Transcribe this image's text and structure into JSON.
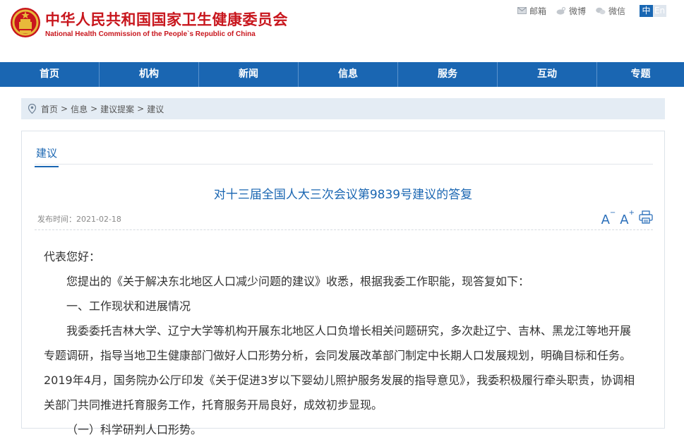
{
  "header": {
    "title": "中华人民共和国国家卫生健康委员会",
    "subtitle": "National Health Commission of the People`s Republic of China"
  },
  "toplinks": {
    "mail": "邮箱",
    "weibo": "微博",
    "wechat": "微信",
    "lang_zh": "中",
    "lang_en": "En"
  },
  "nav": {
    "items": [
      "首页",
      "机构",
      "新闻",
      "信息",
      "服务",
      "互动",
      "专题"
    ]
  },
  "breadcrumb": {
    "items": [
      "首页",
      "信息",
      "建议提案",
      "建议"
    ],
    "separator": ">"
  },
  "section": {
    "tab": "建议"
  },
  "article": {
    "title": "对十三届全国人大三次会议第9839号建议的答复",
    "date_label": "发布时间：",
    "date": "2021-02-18",
    "font_increase": "A",
    "font_decrease": "A",
    "paragraphs": [
      "代表您好：",
      "您提出的《关于解决东北地区人口减少问题的建议》收悉，根据我委工作职能，现答复如下：",
      "一、工作现状和进展情况",
      "我委委托吉林大学、辽宁大学等机构开展东北地区人口负增长相关问题研究，多次赴辽宁、吉林、黑龙江等地开展专题调研，指导当地卫生健康部门做好人口形势分析，会同发展改革部门制定中长期人口发展规划，明确目标和任务。2019年4月，国务院办公厅印发《关于促进3岁以下婴幼儿照护服务发展的指导意见》，我委积极履行牵头职责，协调相关部门共同推进托育服务工作，托育服务开局良好，成效初步显现。",
      "（一）科学研判人口形势。"
    ]
  }
}
